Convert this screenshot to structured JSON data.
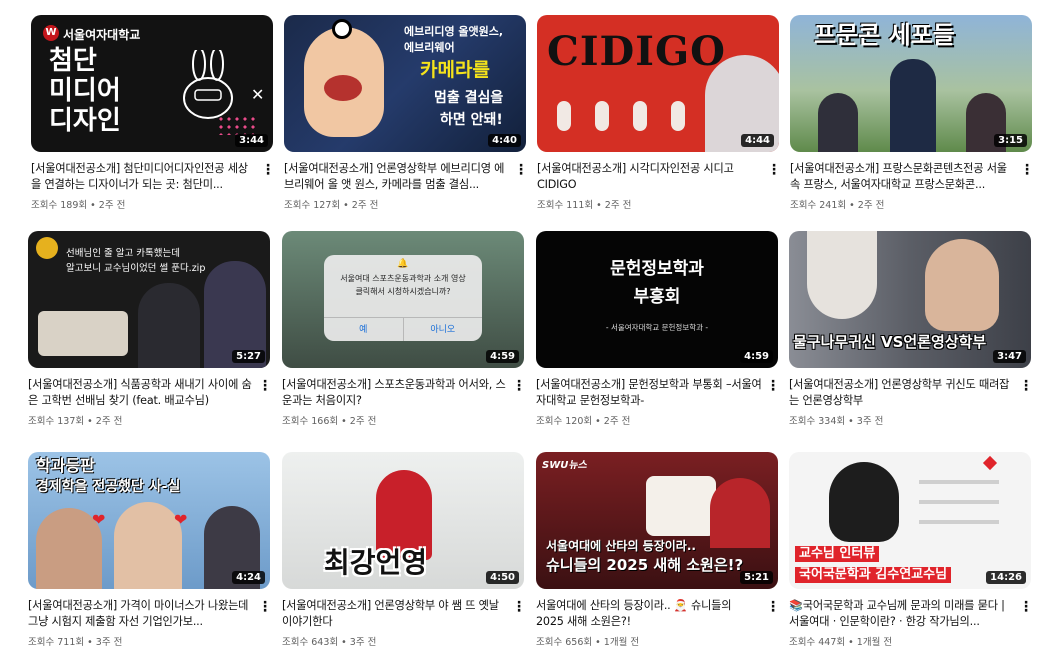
{
  "videos": [
    {
      "title": "[서울여대전공소개] 첨단미디어디자인전공 세상을 연결하는 디자이너가 되는 곳: 첨단미...",
      "views": "조회수 189회",
      "age": "2주 전",
      "duration": "3:44",
      "thumb": {
        "school": "서울여자대학교",
        "line1": "첨단",
        "line2": "미디어",
        "line3": "디자인"
      }
    },
    {
      "title": "[서울여대전공소개] 언론영상학부 에브리디영 에브리웨어 올 앳 원스, 카메라를 멈출 결심...",
      "views": "조회수 127회",
      "age": "2주 전",
      "duration": "4:40",
      "thumb": {
        "line1": "에브리디영 올앳원스,",
        "line2": "에브리웨어",
        "line3": "카메라를",
        "line4": "멈출 결심을",
        "line5": "하면 안돼!"
      }
    },
    {
      "title": "[서울여대전공소개] 시각디자인전공 시디고 CIDIGO",
      "views": "조회수 111회",
      "age": "2주 전",
      "duration": "4:44",
      "thumb": {
        "line1": "CIDIGO"
      }
    },
    {
      "title": "[서울여대전공소개] 프랑스문화콘텐츠전공 서울 속 프랑스, 서울여자대학교 프랑스문화콘...",
      "views": "조회수 241회",
      "age": "2주 전",
      "duration": "3:15",
      "thumb": {
        "line1": "프문콘 세포들"
      }
    },
    {
      "title": "[서울여대전공소개] 식품공학과 새내기 사이에 숨은 고학번 선배님 찾기 (feat. 배교수님)",
      "views": "조회수 137회",
      "age": "2주 전",
      "duration": "5:27",
      "thumb": {
        "line1": "선배님인 줄 알고 카톡했는데",
        "line2": "알고보니 교수님이었던 썰 푼다.zip"
      }
    },
    {
      "title": "[서울여대전공소개] 스포츠운동과학과 어서와, 스운과는 처음이지?",
      "views": "조회수 166회",
      "age": "2주 전",
      "duration": "4:59",
      "thumb": {
        "line1": "서울여대 스포츠운동과학과 소개 영상",
        "line2": "클릭해서 시청하시겠습니까?",
        "yes": "예",
        "no": "아니오"
      }
    },
    {
      "title": "[서울여대전공소개] 문헌정보학과 부통회 –서울여자대학교 문헌정보학과-",
      "views": "조회수 120회",
      "age": "2주 전",
      "duration": "4:59",
      "thumb": {
        "line1": "문헌정보학과",
        "line2": "부흥회",
        "line3": "- 서울여자대학교 문헌정보학과 -"
      }
    },
    {
      "title": "[서울여대전공소개] 언론영상학부 귀신도 때려잡는 언론영상학부",
      "views": "조회수 334회",
      "age": "3주 전",
      "duration": "3:47",
      "thumb": {
        "line1": "물구나무귀신 VS언론영상학부"
      }
    },
    {
      "title": "[서울여대전공소개] 가격이 마이너스가 나왔는데 그냥 시험지 제출함 자선 기업인가보...",
      "views": "조회수 711회",
      "age": "3주 전",
      "duration": "4:24",
      "thumb": {
        "line1": "학과등판",
        "line2": "경제학을 전공했단 사-실"
      }
    },
    {
      "title": "[서울여대전공소개] 언론영상학부 야 쌤 뜨 옛날 이야기한다",
      "views": "조회수 643회",
      "age": "3주 전",
      "duration": "4:50",
      "thumb": {
        "line1": "최강언영"
      }
    },
    {
      "title": "서울여대에 산타의 등장이라.. 🎅 슈니들의 2025 새해 소원은?!",
      "views": "조회수 656회",
      "age": "1개월 전",
      "duration": "5:21",
      "thumb": {
        "tag": "SWU뉴스",
        "line1": "서울여대에 산타의 등장이라..",
        "line2": "슈니들의 2025 새해 소원은!?"
      }
    },
    {
      "title": "📚국어국문학과 교수님께 문과의 미래를 묻다 | 서울여대 · 인문학이란? · 한강 작가님의...",
      "views": "조회수 447회",
      "age": "1개월 전",
      "duration": "14:26",
      "thumb": {
        "line1": "교수님 인터뷰",
        "line2": "국어국문학과 김수연교수님"
      }
    }
  ],
  "colors": {
    "accent_red": "#e0242b",
    "text": "#0f0f0f",
    "meta": "#606060"
  },
  "icons": {
    "more": "more-vert-icon"
  }
}
